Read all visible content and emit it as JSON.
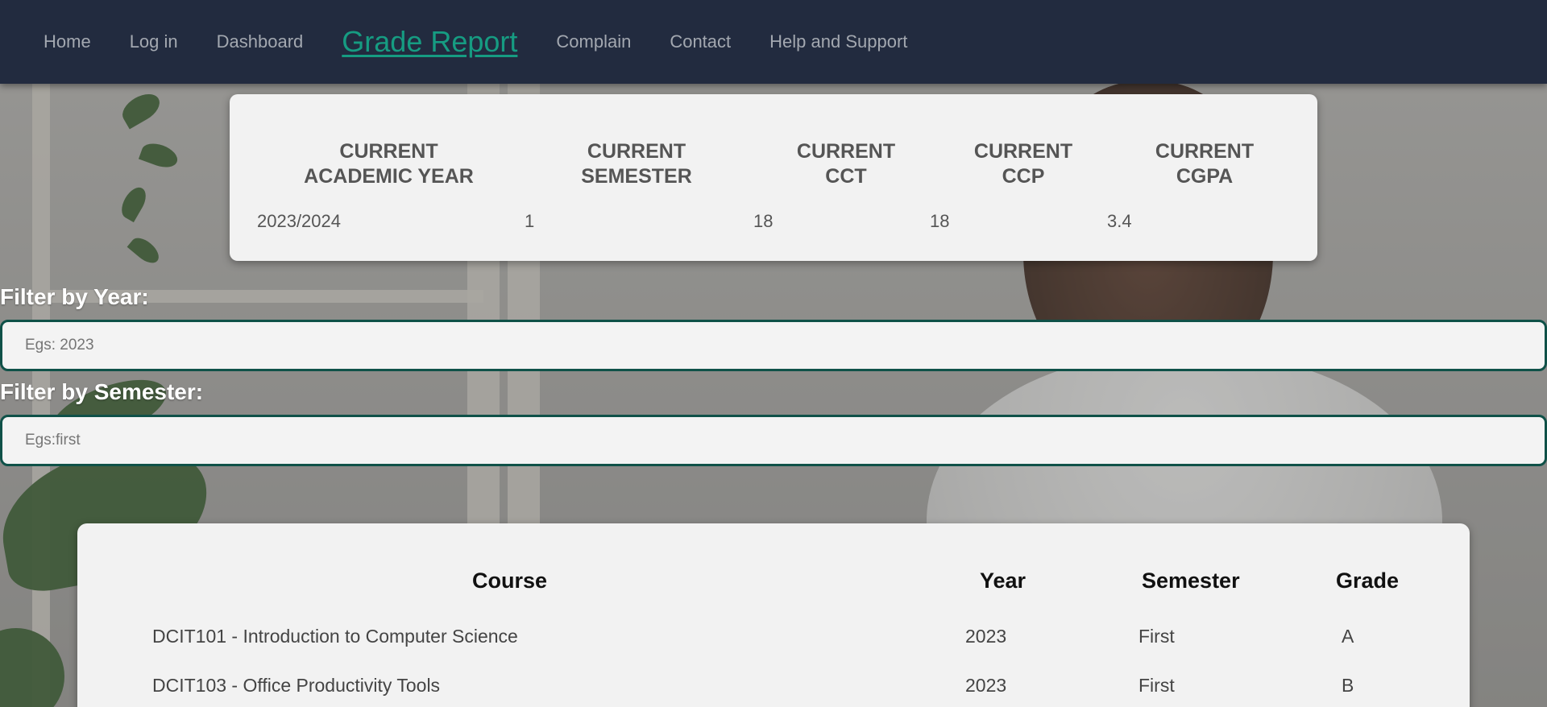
{
  "nav": {
    "items": [
      {
        "label": "Home"
      },
      {
        "label": "Log in"
      },
      {
        "label": "Dashboard"
      },
      {
        "label": "Grade Report"
      },
      {
        "label": "Complain"
      },
      {
        "label": "Contact"
      },
      {
        "label": "Help and Support"
      }
    ],
    "active_index": 3,
    "active_color": "#169c82",
    "background_color": "#222b3f"
  },
  "summary": {
    "headers": [
      {
        "line1": "CURRENT",
        "line2": "ACADEMIC YEAR"
      },
      {
        "line1": "CURRENT",
        "line2": "SEMESTER"
      },
      {
        "line1": "CURRENT",
        "line2": "CCT"
      },
      {
        "line1": "CURRENT",
        "line2": "CCP"
      },
      {
        "line1": "CURRENT",
        "line2": "CGPA"
      }
    ],
    "values": [
      "2023/2024",
      "1",
      "18",
      "18",
      "3.4"
    ]
  },
  "filters": {
    "year_label": "Filter by Year:",
    "year_placeholder": "Egs: 2023",
    "year_value": "",
    "semester_label": "Filter by Semester:",
    "semester_placeholder": "Egs:first",
    "semester_value": "",
    "border_color": "#0f5148"
  },
  "grades": {
    "columns": [
      "Course",
      "Year",
      "Semester",
      "Grade"
    ],
    "rows": [
      {
        "course": "DCIT101 - Introduction to Computer Science",
        "year": "2023",
        "semester": "First",
        "grade": "A"
      },
      {
        "course": "DCIT103 - Office Productivity Tools",
        "year": "2023",
        "semester": "First",
        "grade": "B"
      }
    ]
  }
}
